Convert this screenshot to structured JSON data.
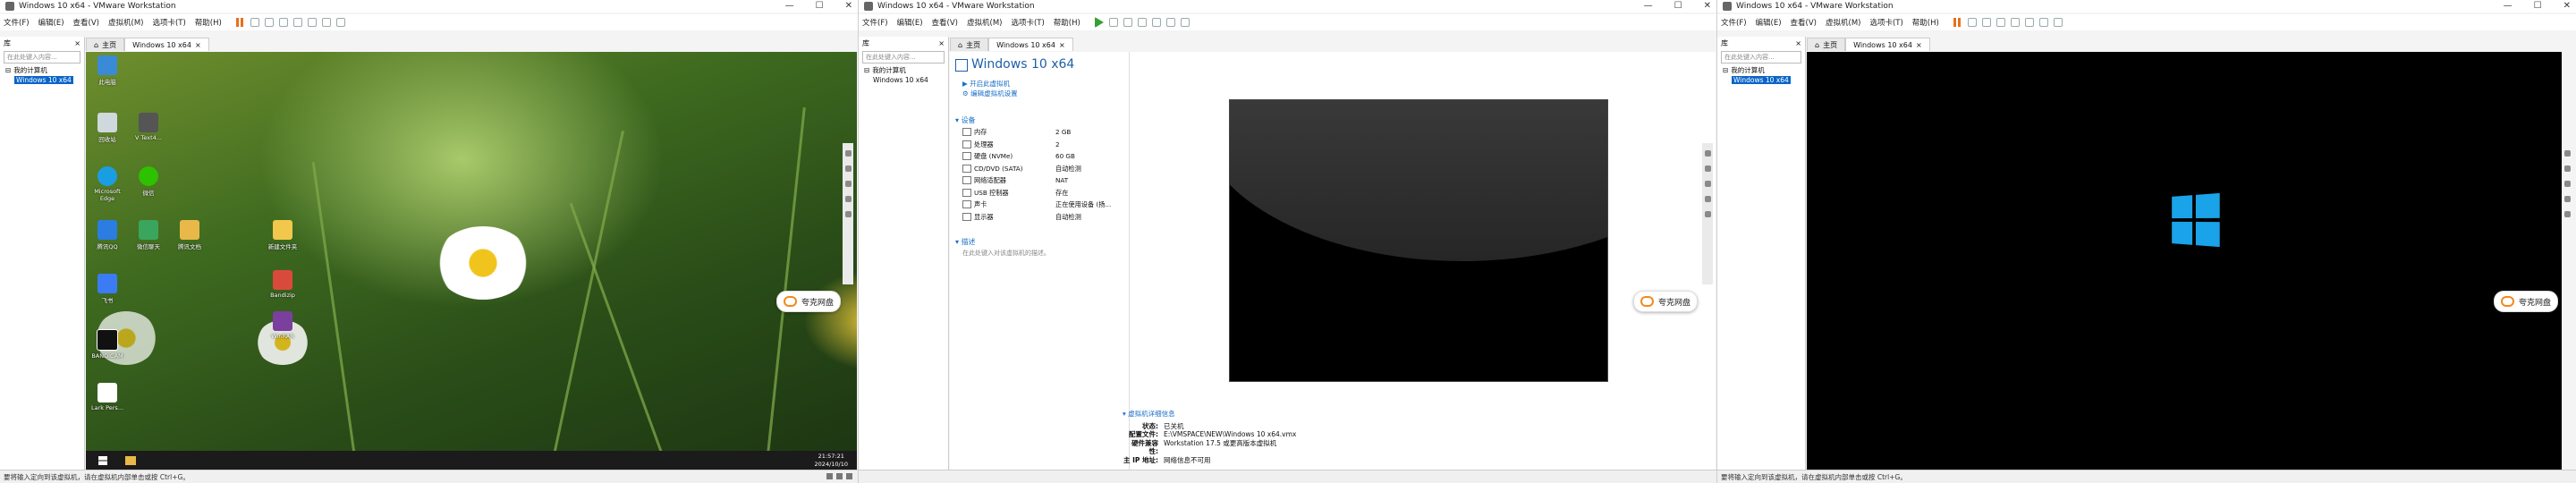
{
  "window": {
    "title": "Windows 10 x64 - VMware Workstation",
    "minimize": "—",
    "maximize": "☐",
    "close": "✕"
  },
  "menu": [
    "文件(F)",
    "编辑(E)",
    "查看(V)",
    "虚拟机(M)",
    "选项卡(T)",
    "帮助(H)"
  ],
  "library": {
    "header": "库",
    "close": "×",
    "search_placeholder": "在此处键入内容...",
    "root": "我的计算机",
    "vm": "Windows 10 x64"
  },
  "tabs": {
    "home": "主页",
    "vm": "Windows 10 x64"
  },
  "desktop": {
    "icons": [
      "此电脑",
      "回收站",
      "Microsoft Edge",
      "腾讯QQ",
      "飞书",
      "微信",
      "BANDICAM",
      "Lark Pers...",
      "V Text4...",
      "腾讯文档",
      "微信聊天",
      "新建文件夹",
      "Bandizip",
      "WinRAR"
    ],
    "tray_time": "21:57:21",
    "tray_date": "2024/10/10",
    "cloud_label": "夸克网盘"
  },
  "summary": {
    "vm_name": "Windows 10 x64",
    "actions": [
      "开启此虚拟机",
      "编辑虚拟机设置"
    ],
    "devices_header": "设备",
    "devices": [
      {
        "k": "内存",
        "v": "2 GB"
      },
      {
        "k": "处理器",
        "v": "2"
      },
      {
        "k": "硬盘 (NVMe)",
        "v": "60 GB"
      },
      {
        "k": "CD/DVD (SATA)",
        "v": "自动检测"
      },
      {
        "k": "网络适配器",
        "v": "NAT"
      },
      {
        "k": "USB 控制器",
        "v": "存在"
      },
      {
        "k": "声卡",
        "v": "正在使用设备 (扬..."
      },
      {
        "k": "显示器",
        "v": "自动检测"
      }
    ],
    "description_header": "描述",
    "description_placeholder": "在此处键入对该虚拟机的描述。",
    "details_header": "虚拟机详细信息",
    "details": [
      {
        "k": "状态:",
        "v": "已关机"
      },
      {
        "k": "配置文件:",
        "v": "E:\\VMSPACE\\NEW\\Windows 10 x64.vmx"
      },
      {
        "k": "硬件兼容性:",
        "v": "Workstation 17.5 或更高版本虚拟机"
      },
      {
        "k": "主 IP 地址:",
        "v": "网络信息不可用"
      }
    ],
    "cloud_label": "夸克网盘"
  },
  "pane3": {
    "cloud_label": "夸克网盘"
  },
  "status": {
    "hint": "要将输入定向到该虚拟机，请在虚拟机内部单击或按 Ctrl+G。"
  },
  "colors": {
    "accent": "#0a64c8",
    "pause": "#e8701a",
    "power": "#36a035",
    "win_logo": "#1aa3e8"
  }
}
